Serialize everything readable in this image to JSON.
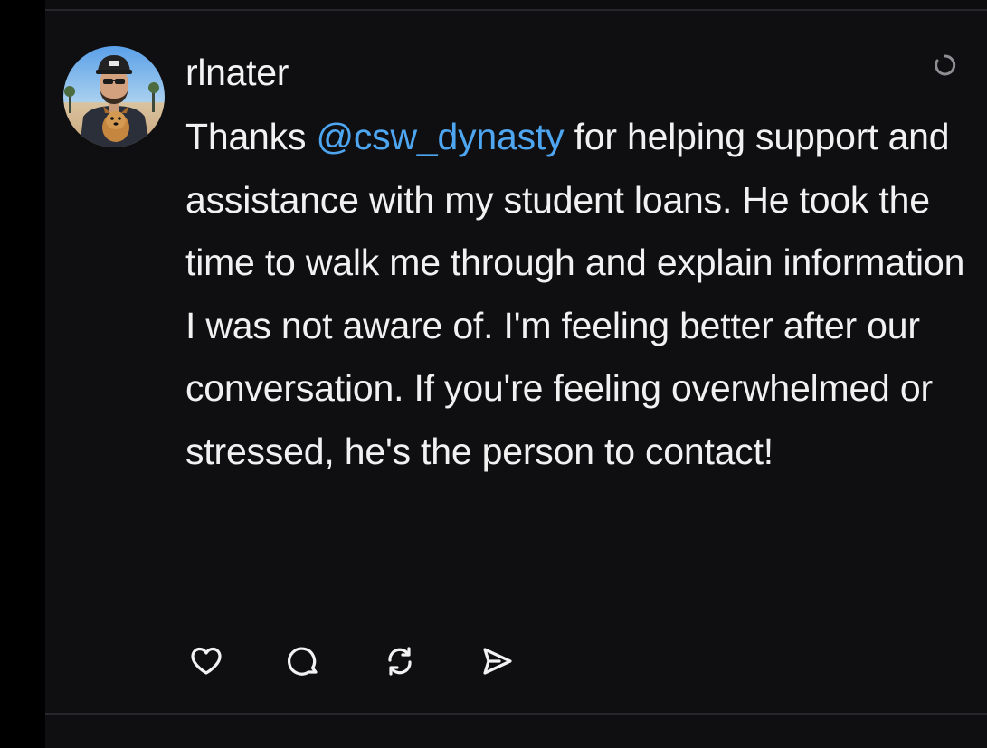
{
  "post": {
    "username": "rlnater",
    "text_before_mention": "Thanks ",
    "mention": "@csw_dynasty",
    "text_after_mention": " for helping support and assistance with my student loans. He took the time to walk me through and explain information I was not aware of. I'm feeling better after our conversation. If you're feeling overwhelmed or stressed, he's the person to contact!",
    "avatar_icon": "profile-photo",
    "more_icon": "loading-spinner-icon"
  },
  "actions": [
    {
      "icon": "heart-icon",
      "label": "Like"
    },
    {
      "icon": "comment-icon",
      "label": "Reply"
    },
    {
      "icon": "repost-icon",
      "label": "Repost"
    },
    {
      "icon": "share-icon",
      "label": "Share"
    }
  ],
  "colors": {
    "background": "#0f0f11",
    "text": "#f1f1f1",
    "mention": "#4ea5f0",
    "divider": "#26272a"
  }
}
